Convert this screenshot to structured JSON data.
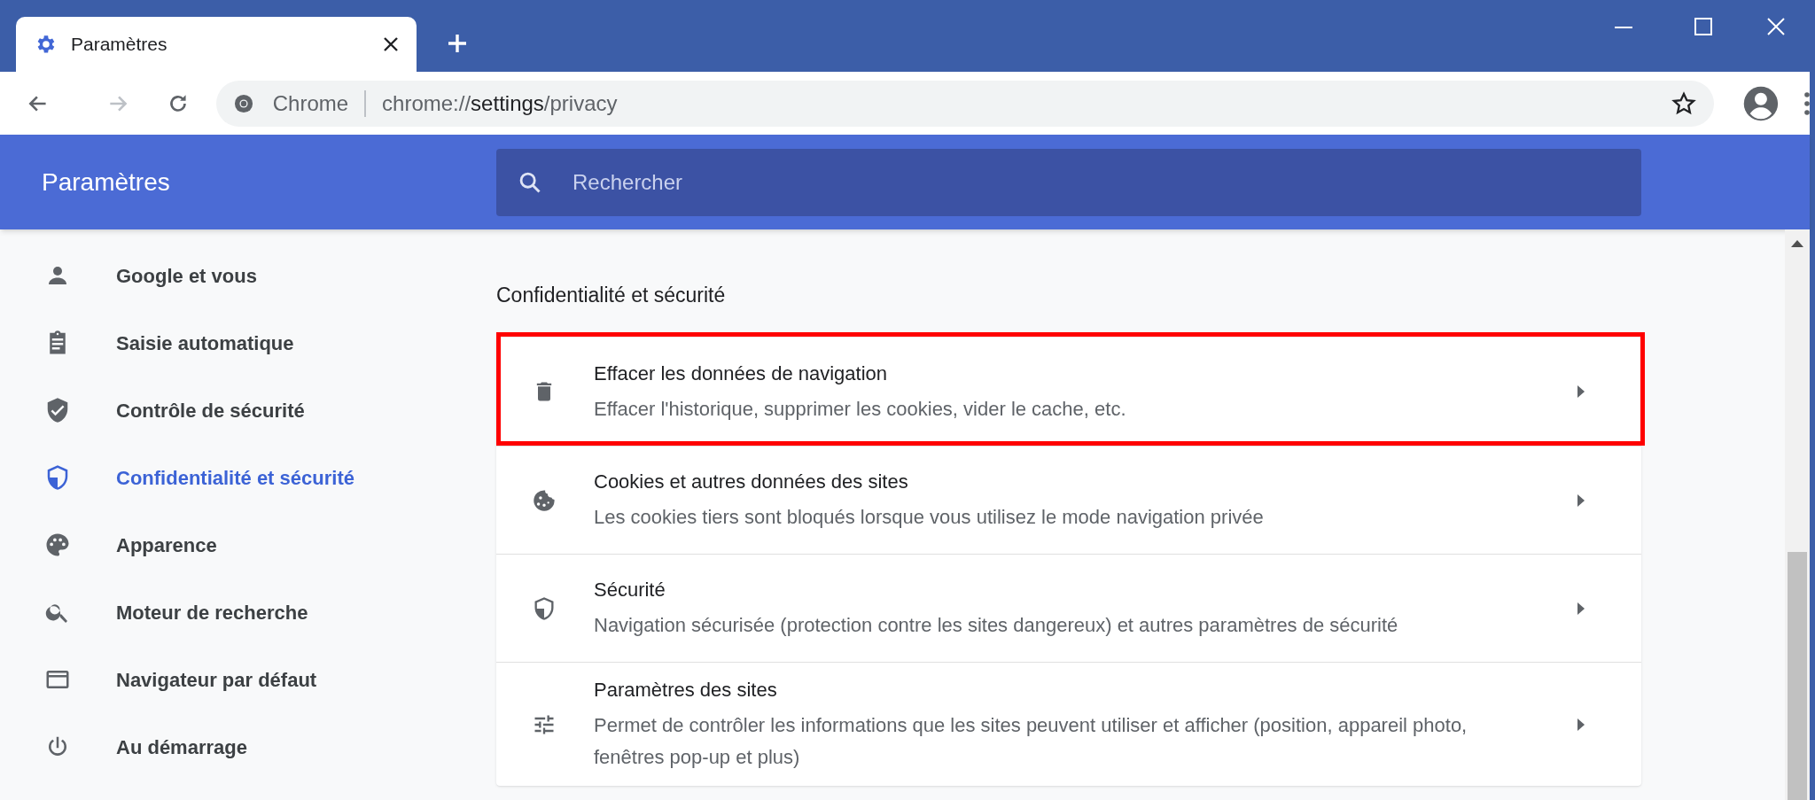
{
  "tab": {
    "title": "Paramètres"
  },
  "address_bar": {
    "site_label": "Chrome",
    "url_parts": [
      {
        "text": "chrome://",
        "emphasis": false
      },
      {
        "text": "settings",
        "emphasis": true
      },
      {
        "text": "/privacy",
        "emphasis": false
      }
    ]
  },
  "header": {
    "title": "Paramètres",
    "search": {
      "placeholder": "Rechercher"
    }
  },
  "sidebar": {
    "items": [
      {
        "label": "Google et vous",
        "selected": false
      },
      {
        "label": "Saisie automatique",
        "selected": false
      },
      {
        "label": "Contrôle de sécurité",
        "selected": false
      },
      {
        "label": "Confidentialité et sécurité",
        "selected": true
      },
      {
        "label": "Apparence",
        "selected": false
      },
      {
        "label": "Moteur de recherche",
        "selected": false
      },
      {
        "label": "Navigateur par défaut",
        "selected": false
      },
      {
        "label": "Au démarrage",
        "selected": false
      }
    ]
  },
  "section": {
    "title": "Confidentialité et sécurité",
    "rows": [
      {
        "title": "Effacer les données de navigation",
        "description": "Effacer l'historique, supprimer les cookies, vider le cache, etc.",
        "highlighted": true
      },
      {
        "title": "Cookies et autres données des sites",
        "description": "Les cookies tiers sont bloqués lorsque vous utilisez le mode navigation privée",
        "highlighted": false
      },
      {
        "title": "Sécurité",
        "description": "Navigation sécurisée (protection contre les sites dangereux) et autres paramètres de sécurité",
        "highlighted": false
      },
      {
        "title": "Paramètres des sites",
        "description": "Permet de contrôler les informations que les sites peuvent utiliser et afficher (position, appareil photo, fenêtres pop-up et plus)",
        "highlighted": false
      }
    ]
  }
}
